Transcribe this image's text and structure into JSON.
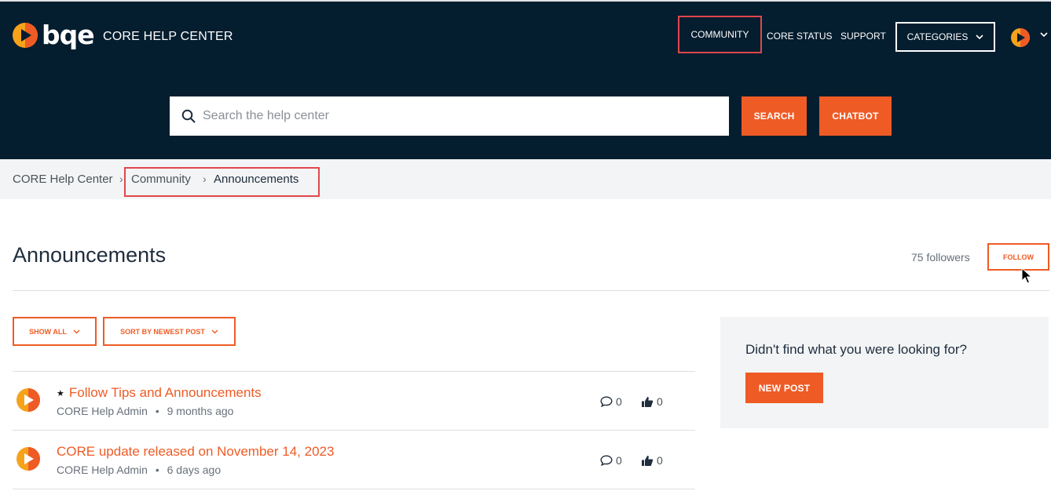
{
  "header": {
    "logo_text": "bqe",
    "site_title": "CORE HELP CENTER",
    "nav": {
      "community": "COMMUNITY",
      "core_status": "CORE STATUS",
      "support": "SUPPORT",
      "categories": "CATEGORIES"
    }
  },
  "search": {
    "placeholder": "Search the help center",
    "search_button": "SEARCH",
    "chatbot_button": "CHATBOT"
  },
  "breadcrumb": {
    "items": [
      "CORE Help Center",
      "Community",
      "Announcements"
    ],
    "separator": "›"
  },
  "page": {
    "title": "Announcements",
    "followers": "75 followers",
    "follow_button": "FOLLOW"
  },
  "filters": {
    "show_all": "SHOW ALL",
    "sort": "SORT BY NEWEST POST"
  },
  "posts": [
    {
      "title": "Follow Tips and Announcements",
      "pinned": true,
      "author": "CORE Help Admin",
      "age": "9 months ago",
      "comments": "0",
      "votes": "0"
    },
    {
      "title": "CORE update released on November 14, 2023",
      "pinned": false,
      "author": "CORE Help Admin",
      "age": "6 days ago",
      "comments": "0",
      "votes": "0"
    }
  ],
  "sidebar": {
    "prompt": "Didn't find what you were looking for?",
    "new_post_button": "NEW POST"
  },
  "meta_separator": "•",
  "colors": {
    "header_bg": "#041d2f",
    "accent": "#ef5b25",
    "highlight_box": "#e0474c",
    "breadcrumb_bg": "#f3f4f5"
  }
}
